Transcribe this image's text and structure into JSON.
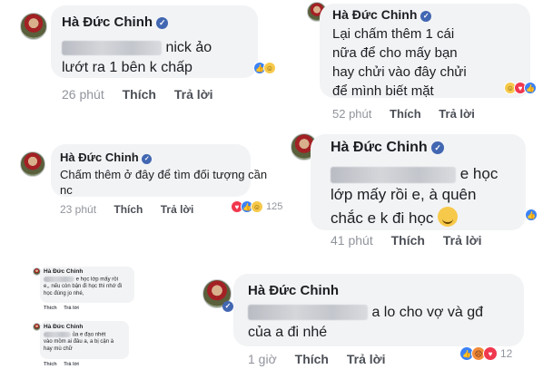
{
  "comments": [
    {
      "name": "Hà Đức Chinh",
      "verified_icon": "check-icon",
      "line1_suffix": "nick ảo",
      "line2": "lướt ra 1 bên k chấp",
      "time": "26 phút",
      "like_label": "Thích",
      "reply_label": "Trả lời",
      "reactions": [
        "like",
        "haha"
      ]
    },
    {
      "name": "Hà Đức Chinh",
      "verified_icon": "check-icon",
      "lines": [
        "Lại chấm thêm 1 cái",
        "nữa để cho mấy bạn",
        "hay chửi vào đây chửi",
        "để mình biết mặt"
      ],
      "time": "52 phút",
      "like_label": "Thích",
      "reply_label": "Trả lời",
      "reactions": [
        "haha",
        "love",
        "like"
      ]
    },
    {
      "name": "Hà Đức Chinh",
      "verified_icon": "check-icon",
      "lines": [
        "Chấm thêm ở đây để tìm đối tượng cần",
        "nc"
      ],
      "time": "23 phút",
      "like_label": "Thích",
      "reply_label": "Trả lời",
      "reactions": [
        "love",
        "like",
        "haha"
      ],
      "reaction_count": "125"
    },
    {
      "name": "Hà Đức Chinh",
      "verified_icon": "check-icon",
      "line1_suffix": "e học",
      "line2": "lớp mấy rồi e, à quên",
      "line3": "chắc e k đi học",
      "time": "41 phút",
      "like_label": "Thích",
      "reply_label": "Trả lời",
      "reactions": [
        "like"
      ]
    },
    {
      "name": "Hà Đức Chinh",
      "lines": [
        "e học lớp mấy rồi",
        "e,, nếu còn bận đi học thì nhớ đi",
        "học đúng jo nhé,"
      ],
      "time": "",
      "like_label": "Thích",
      "reply_label": "Trả lời"
    },
    {
      "name": "Hà Đức Chinh",
      "lines": [
        "ủa e đạo nhét",
        "vào mồm ai đâu a, a bị cận à",
        "hay mù chữ"
      ],
      "time": "",
      "like_label": "Thích",
      "reply_label": "Trả lời"
    },
    {
      "name": "Hà Đức Chinh",
      "verified_icon": "check-icon",
      "line1_suffix": "a lo cho vợ và gđ",
      "line2": "của a đi nhé",
      "time": "1 giờ",
      "like_label": "Thích",
      "reply_label": "Trả lời",
      "reactions": [
        "like",
        "angry",
        "love"
      ],
      "reaction_count": "12"
    }
  ],
  "colors": {
    "bubble": "#f2f3f5",
    "verified": "#4267b2",
    "meta": "#90949c",
    "link": "#4b4f56"
  }
}
